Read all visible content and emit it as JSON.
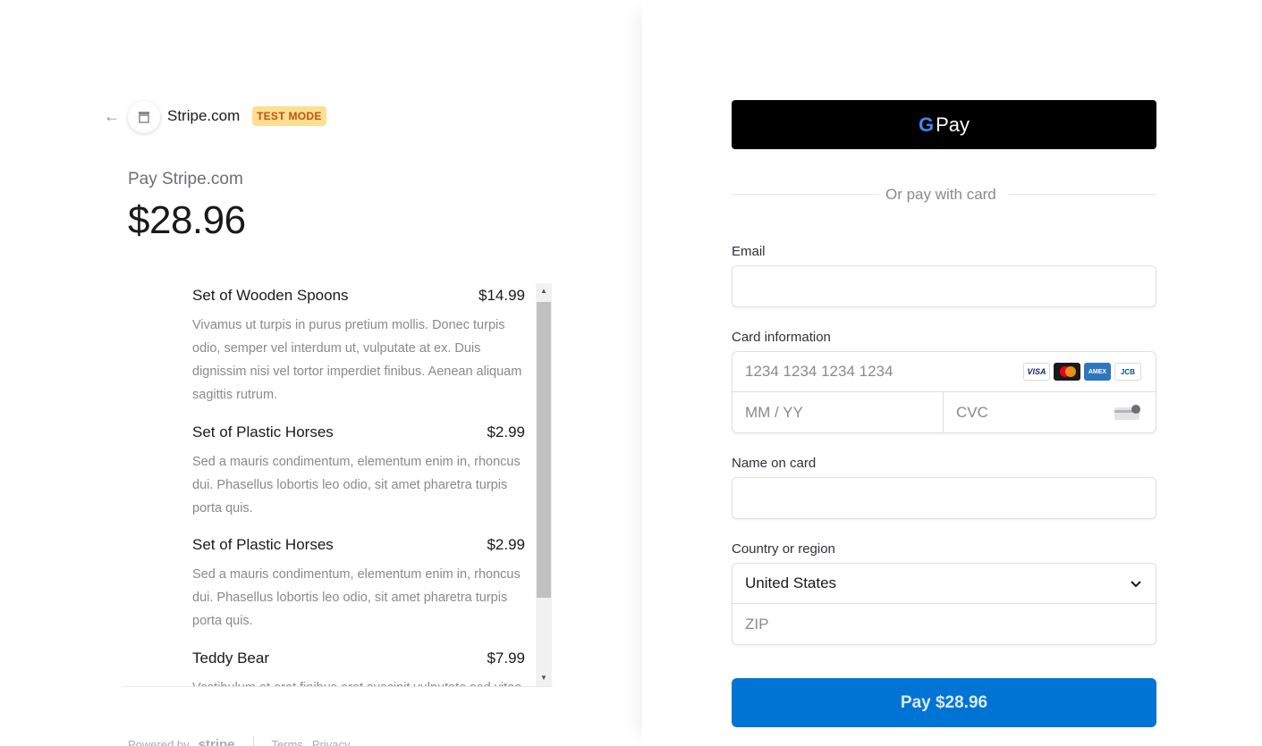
{
  "header": {
    "merchant_name": "Stripe.com",
    "test_badge": "TEST MODE",
    "back_icon": "arrow-left-icon",
    "logo_icon": "store-icon"
  },
  "summary": {
    "pay_label": "Pay Stripe.com",
    "amount": "$28.96"
  },
  "line_items": [
    {
      "name": "Set of Wooden Spoons",
      "price": "$14.99",
      "description": "Vivamus ut turpis in purus pretium mollis. Donec turpis odio, semper vel interdum ut, vulputate at ex. Duis dignissim nisi vel tortor imperdiet finibus. Aenean aliquam sagittis rutrum."
    },
    {
      "name": "Set of Plastic Horses",
      "price": "$2.99",
      "description": "Sed a mauris condimentum, elementum enim in, rhoncus dui. Phasellus lobortis leo odio, sit amet pharetra turpis porta quis."
    },
    {
      "name": "Set of Plastic Horses",
      "price": "$2.99",
      "description": "Sed a mauris condimentum, elementum enim in, rhoncus dui. Phasellus lobortis leo odio, sit amet pharetra turpis porta quis."
    },
    {
      "name": "Teddy Bear",
      "price": "$7.99",
      "description": "Vestibulum et erat finibus erat suscipit vulputate sed vitae dui. Ut laoreet tellus sit amet justo bibendum ultrices."
    }
  ],
  "footer": {
    "powered_by": "Powered by",
    "stripe": "stripe",
    "terms": "Terms",
    "privacy": "Privacy"
  },
  "form": {
    "gpay_g": "G",
    "gpay_label": "Pay",
    "or_text": "Or pay with card",
    "email_label": "Email",
    "email_value": "",
    "card_label": "Card information",
    "card_number_placeholder": "1234 1234 1234 1234",
    "expiry_placeholder": "MM / YY",
    "cvc_placeholder": "CVC",
    "card_brands": [
      "VISA",
      "",
      "AMEX",
      "JCB"
    ],
    "name_label": "Name on card",
    "name_value": "",
    "country_label": "Country or region",
    "country_value": "United States",
    "zip_placeholder": "ZIP",
    "pay_button": "Pay $28.96"
  },
  "colors": {
    "accent": "#0074d4",
    "badge_bg": "#ffde92",
    "badge_text": "#bb5504"
  }
}
